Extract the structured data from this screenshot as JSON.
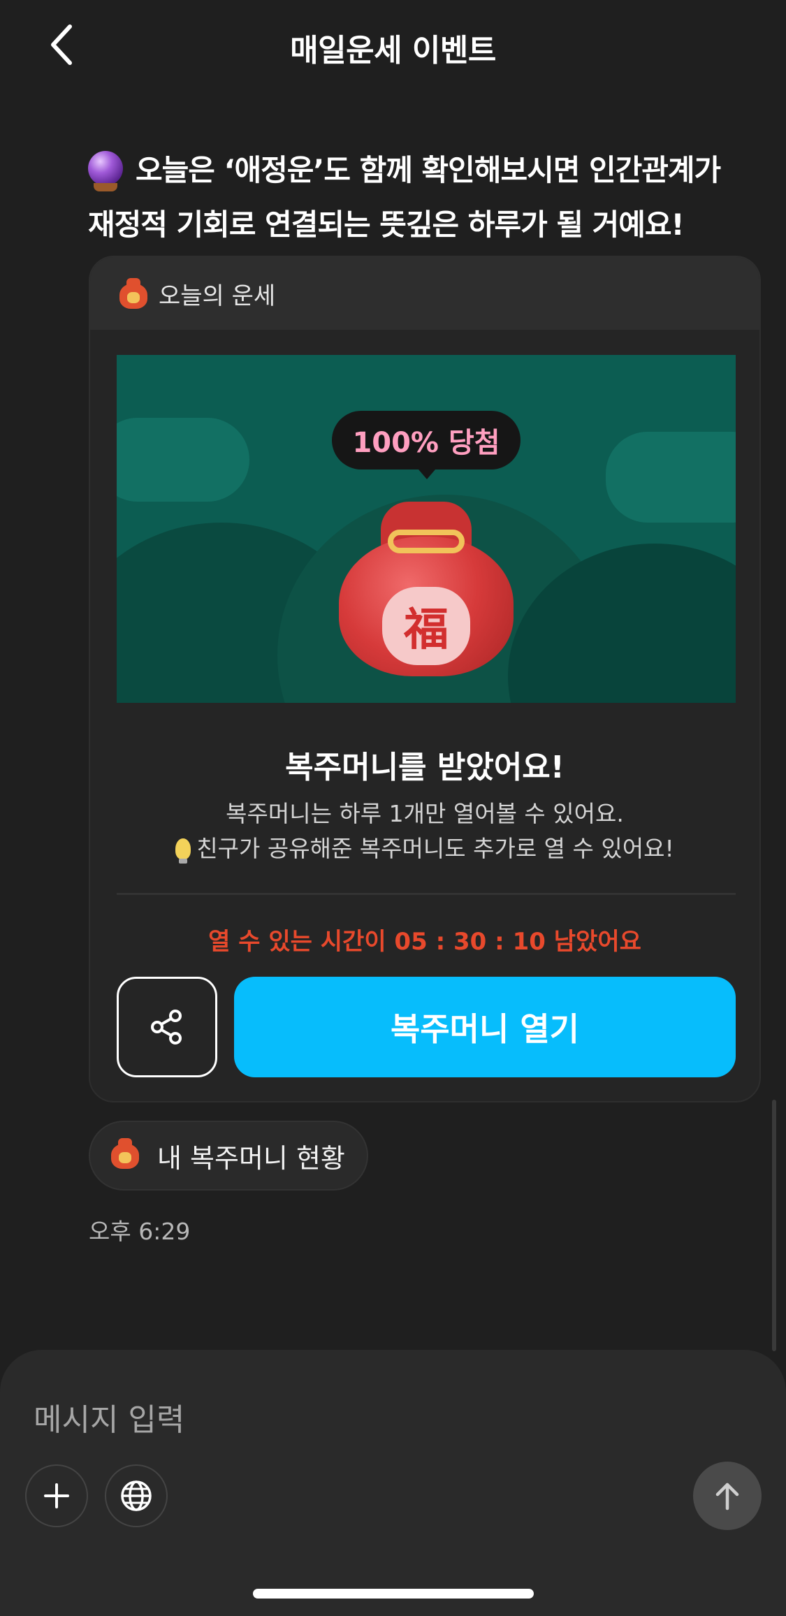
{
  "header": {
    "title": "매일운세 이벤트"
  },
  "message": {
    "line1": "오늘은 ‘애정운’도 함께 확인해보시면 인간관계가",
    "line2": "재정적 기회로 연결되는 뜻깊은 하루가 될 거예요!"
  },
  "card": {
    "header_label": "오늘의 운세",
    "banner_badge": "100% 당첨",
    "banner_seal": "福",
    "title": "복주머니를 받았어요!",
    "desc_line1": "복주머니는 하루 1개만 열어볼 수 있어요.",
    "desc_line2": "친구가 공유해준 복주머니도 추가로 열 수 있어요!",
    "timer": "열 수 있는 시간이 05 : 30 : 10 남았어요",
    "open_button": "복주머니 열기"
  },
  "status_chip": {
    "label": "내 복주머니 현황"
  },
  "timestamp": "오후 6:29",
  "composer": {
    "placeholder": "메시지 입력"
  },
  "colors": {
    "accent": "#07bdfc",
    "timer": "#e8492c",
    "background": "#1f1f1f"
  }
}
